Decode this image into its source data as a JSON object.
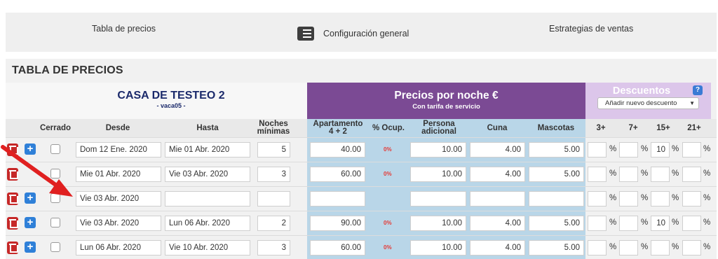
{
  "tabs": {
    "tab1": "Tabla de precios",
    "tab2": "Configuración general",
    "tab3": "Estrategias de ventas",
    "tab2_icon": "list-icon"
  },
  "section_title": "TABLA DE PRECIOS",
  "casa": {
    "name": "CASA DE TESTEO 2",
    "sub": "- vaca05 -"
  },
  "precios": {
    "title": "Precios por noche €",
    "sub": "Con tarifa de servicio"
  },
  "descuentos": {
    "title": "Descuentos",
    "help": "?",
    "select": "Añadir nuevo descuento",
    "caret": "▼"
  },
  "columns": {
    "cerrado": "Cerrado",
    "desde": "Desde",
    "hasta": "Hasta",
    "noches1": "Noches",
    "noches2": "mínimas",
    "apto1": "Apartamento",
    "apto2": "4 + 2",
    "ocup": "% Ocup.",
    "persona1": "Persona",
    "persona2": "adicional",
    "cuna": "Cuna",
    "mascotas": "Mascotas",
    "d3": "3+",
    "d7": "7+",
    "d15": "15+",
    "d21": "21+"
  },
  "rows": [
    {
      "desde": "Dom 12 Ene. 2020",
      "hasta": "Mie 01 Abr. 2020",
      "noches": "5",
      "apto": "40.00",
      "ocup": "0%",
      "persona": "10.00",
      "cuna": "4.00",
      "mascotas": "5.00",
      "d3": "",
      "d7": "",
      "d15": "10",
      "d21": "",
      "pct": "%"
    },
    {
      "desde": "Mie 01 Abr. 2020",
      "hasta": "Vie 03 Abr. 2020",
      "noches": "3",
      "apto": "60.00",
      "ocup": "0%",
      "persona": "10.00",
      "cuna": "4.00",
      "mascotas": "5.00",
      "d3": "",
      "d7": "",
      "d15": "",
      "d21": "",
      "pct": "%"
    },
    {
      "desde": "Vie 03 Abr. 2020",
      "hasta": "",
      "noches": "",
      "apto": "",
      "ocup": "",
      "persona": "",
      "cuna": "",
      "mascotas": "",
      "d3": "",
      "d7": "",
      "d15": "",
      "d21": "",
      "pct": "%"
    },
    {
      "desde": "Vie 03 Abr. 2020",
      "hasta": "Lun 06 Abr. 2020",
      "noches": "2",
      "apto": "90.00",
      "ocup": "0%",
      "persona": "10.00",
      "cuna": "4.00",
      "mascotas": "5.00",
      "d3": "",
      "d7": "",
      "d15": "10",
      "d21": "",
      "pct": "%"
    },
    {
      "desde": "Lun 06 Abr. 2020",
      "hasta": "Vie 10 Abr. 2020",
      "noches": "3",
      "apto": "60.00",
      "ocup": "0%",
      "persona": "10.00",
      "cuna": "4.00",
      "mascotas": "5.00",
      "d3": "",
      "d7": "",
      "d15": "",
      "d21": "",
      "pct": "%"
    }
  ],
  "colors": {
    "purple": "#7b4a94",
    "lavender": "#dcc6ea",
    "blue_col": "#b9d6e8",
    "navy_text": "#1b2a6b",
    "delete_red": "#c62828",
    "add_blue": "#2f80d8",
    "arrow_red": "#e02020"
  }
}
